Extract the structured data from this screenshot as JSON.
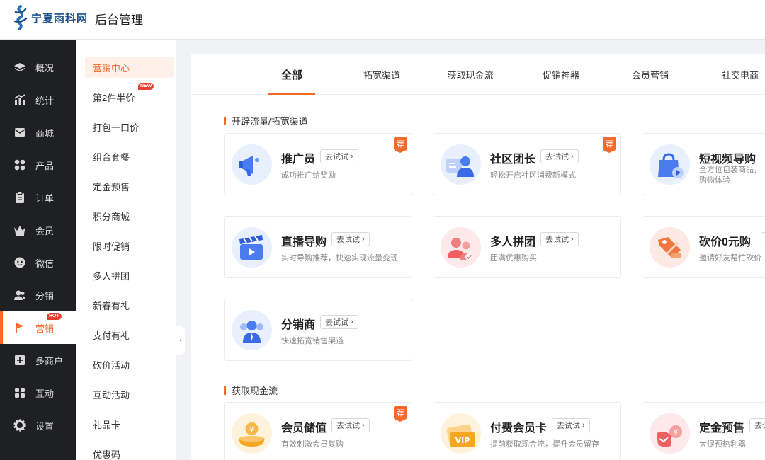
{
  "header": {
    "logo_text": "宁夏雨科网",
    "title": "后台管理"
  },
  "sidebar": {
    "items": [
      {
        "label": "概况",
        "icon": "layers-icon"
      },
      {
        "label": "统计",
        "icon": "chart-icon"
      },
      {
        "label": "商城",
        "icon": "mail-icon"
      },
      {
        "label": "产品",
        "icon": "grid-icon"
      },
      {
        "label": "订单",
        "icon": "clipboard-icon"
      },
      {
        "label": "会员",
        "icon": "crown-icon"
      },
      {
        "label": "微信",
        "icon": "chat-icon"
      },
      {
        "label": "分销",
        "icon": "users-icon"
      },
      {
        "label": "营销",
        "icon": "flag-icon",
        "badge": "HOT"
      },
      {
        "label": "多商户",
        "icon": "store-icon"
      },
      {
        "label": "互动",
        "icon": "apps-icon"
      },
      {
        "label": "设置",
        "icon": "gear-icon"
      }
    ],
    "active": "营销"
  },
  "subnav": {
    "items": [
      {
        "label": "营销中心"
      },
      {
        "label": "第2件半价",
        "badge": "NEW"
      },
      {
        "label": "打包一口价"
      },
      {
        "label": "组合套餐"
      },
      {
        "label": "定金预售"
      },
      {
        "label": "积分商城"
      },
      {
        "label": "限时促销"
      },
      {
        "label": "多人拼团"
      },
      {
        "label": "新春有礼"
      },
      {
        "label": "支付有礼"
      },
      {
        "label": "砍价活动"
      },
      {
        "label": "互动活动"
      },
      {
        "label": "礼品卡"
      },
      {
        "label": "优惠码"
      }
    ],
    "active": "营销中心"
  },
  "tabs": [
    {
      "label": "全部"
    },
    {
      "label": "拓宽渠道"
    },
    {
      "label": "获取现金流"
    },
    {
      "label": "促销神器"
    },
    {
      "label": "会员营销"
    },
    {
      "label": "社交电商"
    }
  ],
  "try_label": "去试试",
  "recommend_label": "荐",
  "sections": [
    {
      "title": "开辟流量/拓宽渠道",
      "cards": [
        {
          "name": "推广员",
          "desc": [
            "成功推广给奖励"
          ],
          "recommended": true,
          "icon": "megaphone-icon"
        },
        {
          "name": "社区团长",
          "desc": [
            "轻松开启社区消费新模式"
          ],
          "recommended": true,
          "icon": "community-leader-icon"
        },
        {
          "name": "短视频导购",
          "desc": [
            "全方位包装商品，",
            "购物体验"
          ],
          "recommended": false,
          "icon": "video-bag-icon"
        },
        {
          "name": "直播导购",
          "desc": [
            "实时导购推荐，快速实现流量变现"
          ],
          "recommended": false,
          "icon": "clapperboard-icon"
        },
        {
          "name": "多人拼团",
          "desc": [
            "团满优惠购买"
          ],
          "recommended": false,
          "icon": "group-buy-icon"
        },
        {
          "name": "砍价0元购",
          "desc": [
            "邀请好友帮忙砍价"
          ],
          "recommended": false,
          "icon": "price-tag-icon"
        },
        {
          "name": "分销商",
          "desc": [
            "快速拓宽销售渠道"
          ],
          "recommended": false,
          "icon": "distributor-icon"
        }
      ]
    },
    {
      "title": "获取现金流",
      "cards": [
        {
          "name": "会员储值",
          "desc": [
            "有效刺激会员复购"
          ],
          "recommended": true,
          "icon": "coin-stack-icon"
        },
        {
          "name": "付费会员卡",
          "desc": [
            "提前获取现金流，提升会员留存"
          ],
          "recommended": false,
          "icon": "vip-card-icon"
        },
        {
          "name": "定金预售",
          "desc": [
            "大促预热利器"
          ],
          "recommended": false,
          "icon": "deposit-icon"
        }
      ]
    }
  ],
  "colors": {
    "accent": "#f56a2a",
    "sidebar_bg": "#1f2024"
  }
}
